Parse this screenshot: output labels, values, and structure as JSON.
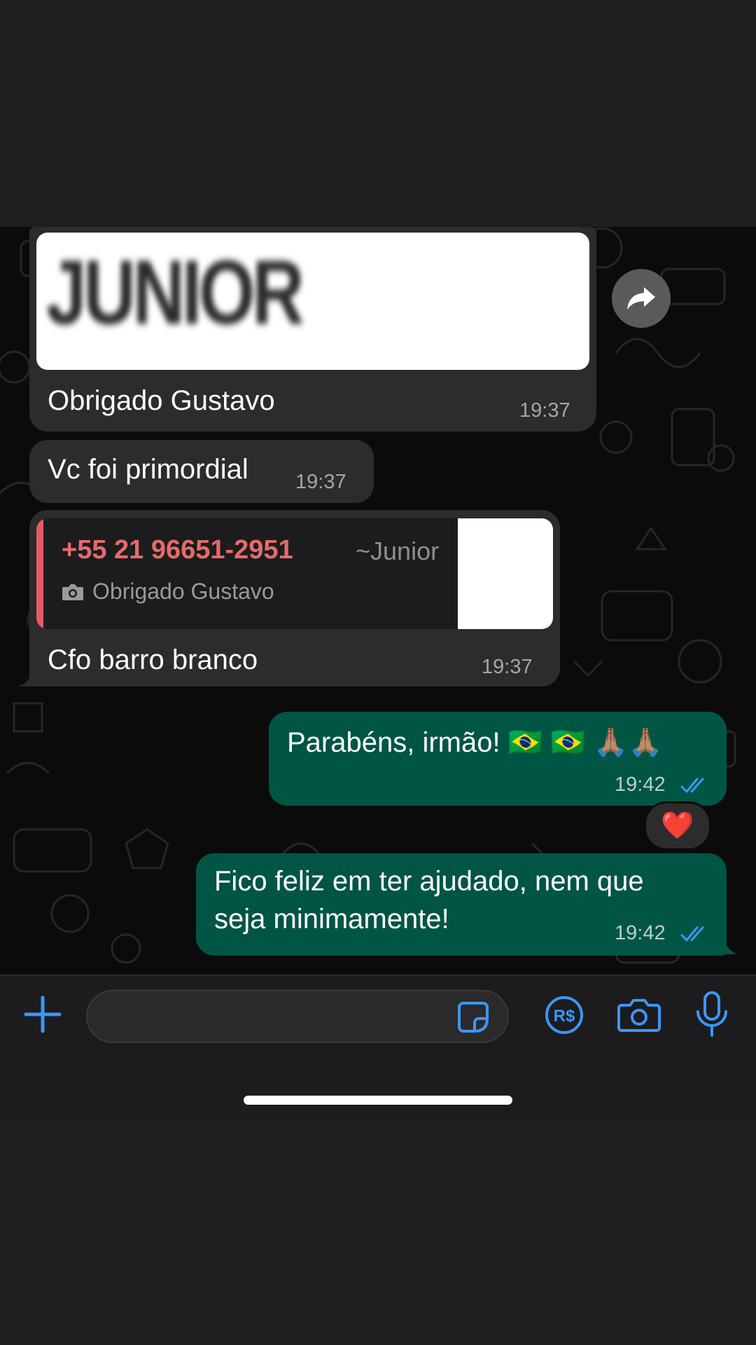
{
  "messages": [
    {
      "id": "m1",
      "direction": "incoming",
      "image_text": "JUNIOR",
      "text": "Obrigado Gustavo",
      "time": "19:37"
    },
    {
      "id": "m2",
      "direction": "incoming",
      "text": "Vc foi primordial",
      "time": "19:37"
    },
    {
      "id": "m3",
      "direction": "incoming",
      "quote": {
        "phone": "+55 21 96651-2951",
        "alias": "~Junior",
        "caption": "Obrigado Gustavo"
      },
      "text": "Cfo barro branco",
      "time": "19:37"
    },
    {
      "id": "m4",
      "direction": "outgoing",
      "text": "Parabéns, irmão! 🇧🇷 🇧🇷 🙏🏽🙏🏽",
      "time": "19:42",
      "status": "read",
      "reaction": "❤️"
    },
    {
      "id": "m5",
      "direction": "outgoing",
      "text_lines": [
        "Fico feliz em ter ajudado, nem que",
        "seja minimamente!"
      ],
      "time": "19:42",
      "status": "read"
    }
  ],
  "colors": {
    "incoming_bubble": "#2c2c2e",
    "outgoing_bubble": "#015544",
    "accent_blue": "#3b97f5",
    "quote_accent": "#e45b65"
  },
  "icons": {
    "forward": "forward-arrow-icon",
    "attach": "plus-icon",
    "sticker": "sticker-icon",
    "payment": "real-currency-icon",
    "camera": "camera-icon",
    "mic": "microphone-icon",
    "read_receipt": "double-check-icon"
  }
}
